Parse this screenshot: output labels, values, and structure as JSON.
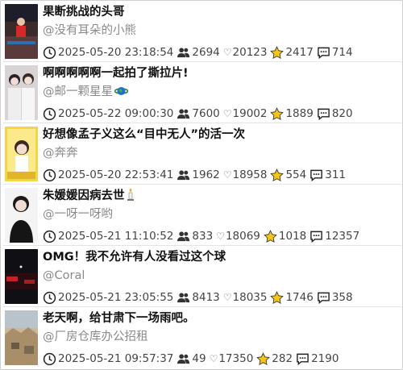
{
  "posts": [
    {
      "title": "果断挑战的头哥",
      "author": "@没有耳朵的小熊",
      "time": "2025-05-20 23:18:54",
      "users": "2694",
      "likes": "20123",
      "stars": "2417",
      "comments": "714"
    },
    {
      "title": "啊啊啊啊啊一起拍了撕拉片!",
      "author": "@邮一颗星星",
      "time": "2025-05-22 09:00:30",
      "users": "7600",
      "likes": "19002",
      "stars": "1889",
      "comments": "820"
    },
    {
      "title": "好想像孟子义这么“目中无人”的活一次",
      "author": "@奔奔",
      "time": "2025-05-20 22:53:41",
      "users": "1962",
      "likes": "18958",
      "stars": "554",
      "comments": "311"
    },
    {
      "title": "朱媛媛因病去世",
      "author": "@一呀一呀哟",
      "time": "2025-05-21 11:10:52",
      "users": "833",
      "likes": "18069",
      "stars": "1018",
      "comments": "12357"
    },
    {
      "title": "OMG！我不允许有人没看过这个球",
      "author": "@Coral",
      "time": "2025-05-21 23:05:55",
      "users": "8413",
      "likes": "18035",
      "stars": "1746",
      "comments": "358"
    },
    {
      "title": "老天啊，给甘肃下一场雨吧。",
      "author": "@厂房仓库办公招租",
      "time": "2025-05-21 09:57:37",
      "users": "49",
      "likes": "17350",
      "stars": "282",
      "comments": "2190"
    }
  ],
  "icons": {
    "clock": "clock-icon",
    "users": "users-icon",
    "heart": "heart-icon",
    "star": "star-icon",
    "comment": "comment-icon"
  },
  "colors": {
    "star": "#f5c518",
    "muted": "#8a8a8a"
  }
}
